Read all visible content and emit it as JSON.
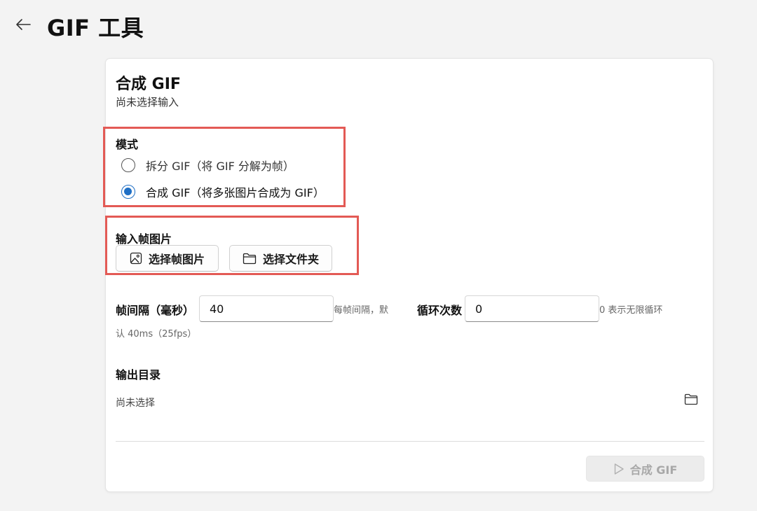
{
  "header": {
    "back_icon": "arrow-left-icon",
    "title": "GIF 工具"
  },
  "card": {
    "title": "合成 GIF",
    "subtitle": "尚未选择输入"
  },
  "mode": {
    "label": "模式",
    "options": [
      {
        "label": "拆分 GIF（将 GIF 分解为帧）",
        "selected": false
      },
      {
        "label": "合成 GIF（将多张图片合成为 GIF）",
        "selected": true
      }
    ]
  },
  "input_frames": {
    "label": "输入帧图片",
    "select_images_label": "选择帧图片",
    "select_images_icon": "image-icon",
    "select_folder_label": "选择文件夹",
    "select_folder_icon": "folder-icon"
  },
  "frame_interval": {
    "label": "帧间隔（毫秒）",
    "value": "40",
    "hint_line1": "每帧间隔，默",
    "hint_line2": "认 40ms（25fps）"
  },
  "loop_count": {
    "label": "循环次数",
    "value": "0",
    "hint": "0 表示无限循环"
  },
  "output_dir": {
    "label": "输出目录",
    "value": "尚未选择",
    "browse_icon": "folder-icon"
  },
  "action": {
    "label": "合成 GIF",
    "icon": "play-icon",
    "enabled": false
  },
  "colors": {
    "highlight": "#e35a55",
    "accent": "#1f6fc5",
    "background": "#f3f3f3"
  }
}
